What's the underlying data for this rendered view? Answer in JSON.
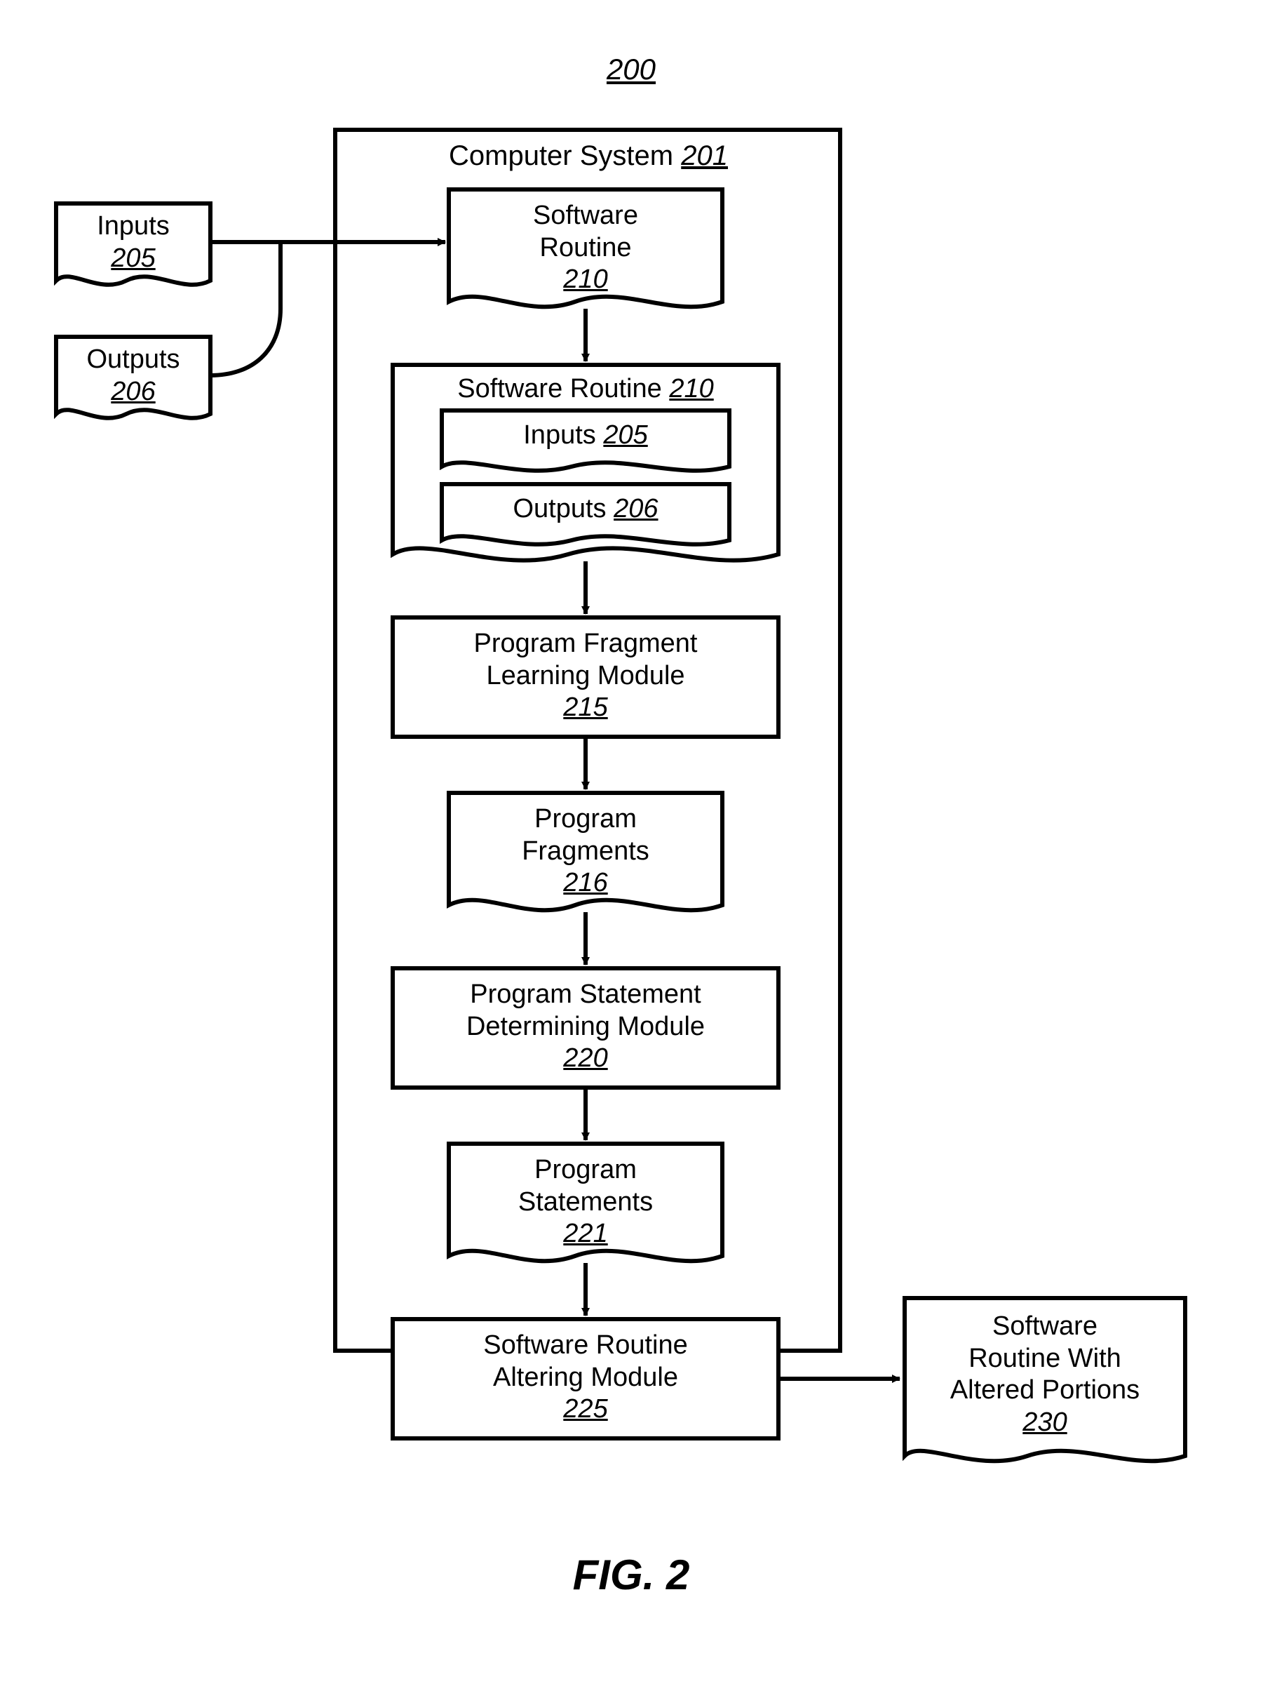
{
  "figure_number": "200",
  "figure_caption": "FIG.  2",
  "computer_system": {
    "label": "Computer System",
    "ref": "201"
  },
  "inputs_ext": {
    "label": "Inputs",
    "ref": "205"
  },
  "outputs_ext": {
    "label": "Outputs",
    "ref": "206"
  },
  "software_routine_top": {
    "label": "Software\nRoutine",
    "ref": "210"
  },
  "software_routine_group": {
    "label": "Software Routine",
    "ref": "210"
  },
  "inputs_inner": {
    "label": "Inputs",
    "ref": "205"
  },
  "outputs_inner": {
    "label": "Outputs",
    "ref": "206"
  },
  "frag_learning": {
    "label": "Program Fragment\nLearning Module",
    "ref": "215"
  },
  "program_fragments": {
    "label": "Program\nFragments",
    "ref": "216"
  },
  "stmt_determining": {
    "label": "Program Statement\nDetermining Module",
    "ref": "220"
  },
  "program_statements": {
    "label": "Program\nStatements",
    "ref": "221"
  },
  "altering_module": {
    "label": "Software Routine\nAltering Module",
    "ref": "225"
  },
  "output_box": {
    "label": "Software\nRoutine With\nAltered Portions",
    "ref": "230"
  }
}
